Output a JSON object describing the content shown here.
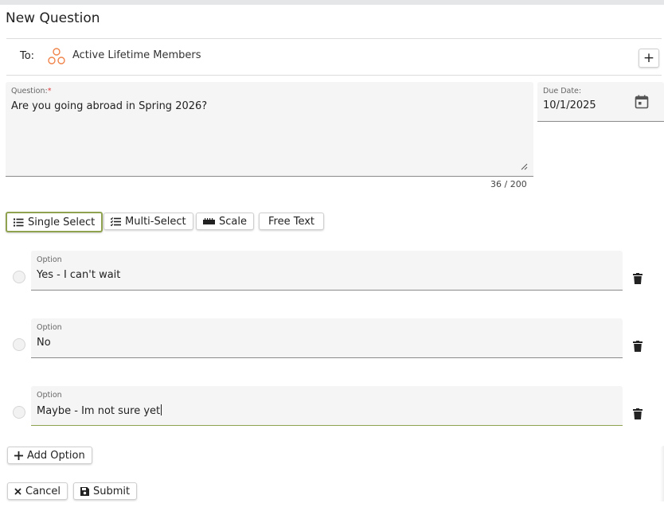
{
  "page": {
    "title": "New Question"
  },
  "recipients": {
    "to_label": "To:",
    "group_name": "Active Lifetime Members",
    "add_label": "+"
  },
  "question": {
    "label": "Question:",
    "required_mark": "*",
    "value": "Are you going abroad in Spring 2026?",
    "counter": "36 / 200"
  },
  "due_date": {
    "label": "Due Date:",
    "value": "10/1/2025"
  },
  "types": [
    {
      "label": "Single Select",
      "selected": true
    },
    {
      "label": "Multi-Select",
      "selected": false
    },
    {
      "label": "Scale",
      "selected": false
    },
    {
      "label": "Free Text",
      "selected": false
    }
  ],
  "options": [
    {
      "label": "Option",
      "value": "Yes - I can't wait"
    },
    {
      "label": "Option",
      "value": "No"
    },
    {
      "label": "Option",
      "value": "Maybe - Im not sure yet"
    }
  ],
  "actions": {
    "add_option": "Add Option",
    "cancel": "Cancel",
    "submit": "Submit"
  },
  "colors": {
    "accent": "#8fa24f",
    "group_icon": "#f0834a",
    "required": "#e03b3b"
  }
}
